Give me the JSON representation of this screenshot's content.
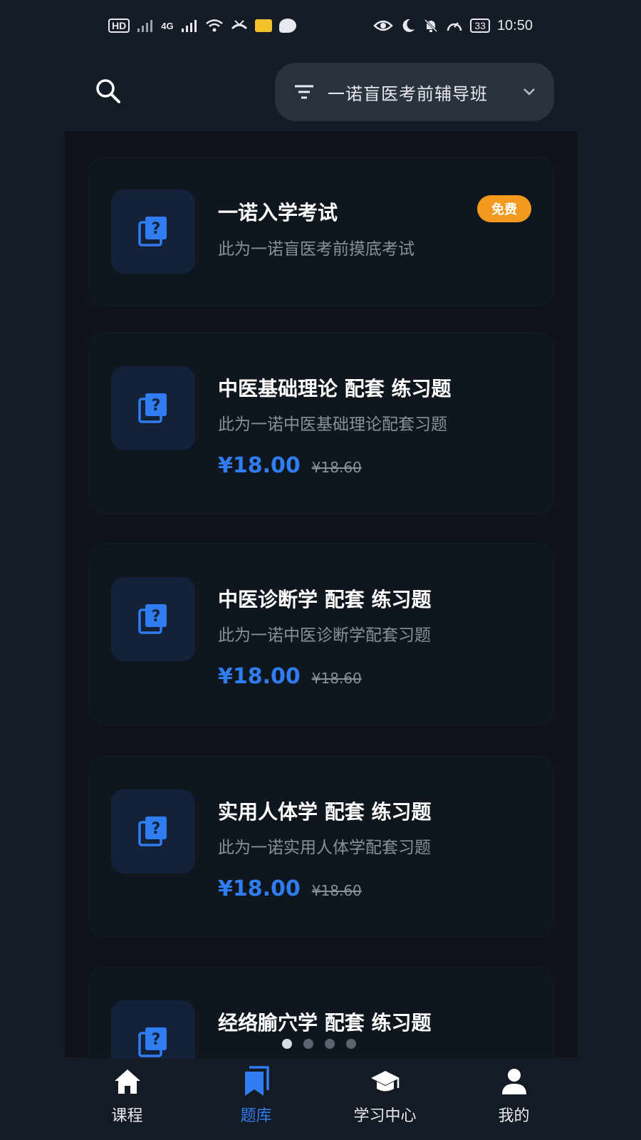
{
  "status_bar": {
    "hd_label": "HD",
    "net_label": "4G",
    "battery": "33",
    "time": "10:50"
  },
  "header": {
    "filter_label": "一诺盲医考前辅导班",
    "icons": [
      "search-icon",
      "filter-icon",
      "chevron-down-icon"
    ]
  },
  "cards": [
    {
      "title": "一诺入学考试",
      "desc": "此为一诺盲医考前摸底考试",
      "badge": "免费"
    },
    {
      "title": "中医基础理论 配套 练习题",
      "desc": "此为一诺中医基础理论配套习题",
      "price": "¥18.00",
      "original_price": "¥18.60"
    },
    {
      "title": "中医诊断学 配套 练习题",
      "desc": "此为一诺中医诊断学配套习题",
      "price": "¥18.00",
      "original_price": "¥18.60"
    },
    {
      "title": "实用人体学 配套 练习题",
      "desc": "此为一诺实用人体学配套习题",
      "price": "¥18.00",
      "original_price": "¥18.60"
    },
    {
      "title": "经络腧穴学 配套 练习题"
    }
  ],
  "bottom_nav": [
    {
      "label": "课程",
      "icon": "home-icon"
    },
    {
      "label": "题库",
      "icon": "bookmarks-icon",
      "active": true
    },
    {
      "label": "学习中心",
      "icon": "graduation-cap-icon"
    },
    {
      "label": "我的",
      "icon": "user-icon"
    }
  ],
  "colors": {
    "accent": "#2f7df0",
    "badge": "#f39a1e",
    "background": "#151c26"
  }
}
